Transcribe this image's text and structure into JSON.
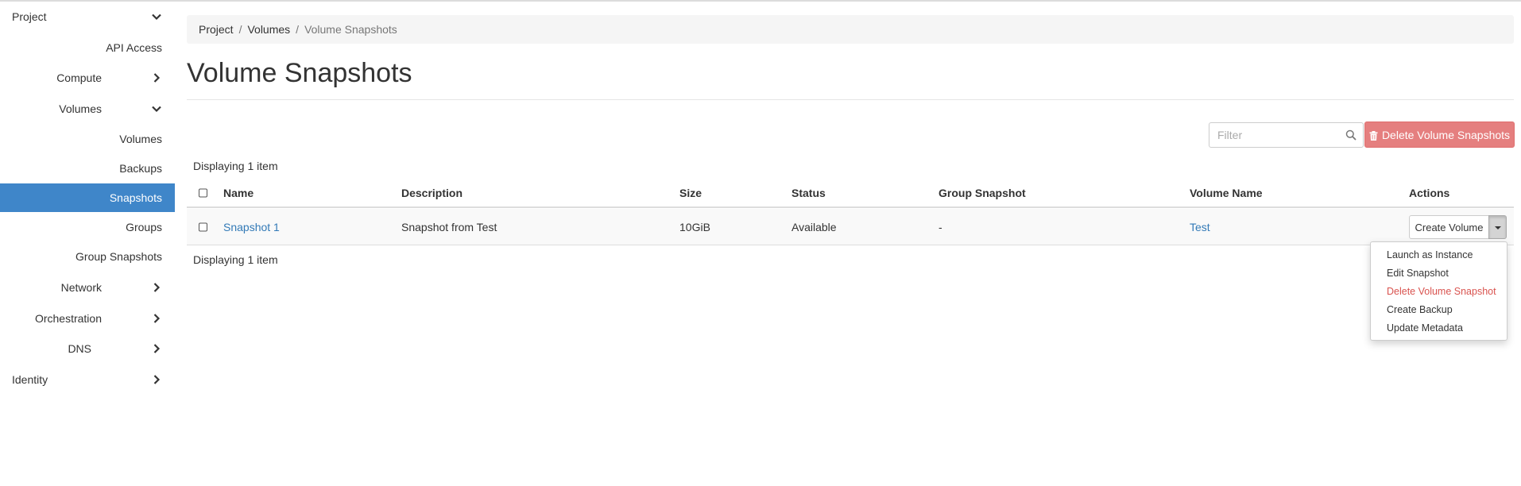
{
  "sidebar": {
    "items": [
      {
        "label": "Project",
        "chevron": "down"
      },
      {
        "label": "API Access"
      },
      {
        "label": "Compute",
        "chevron": "right"
      },
      {
        "label": "Volumes",
        "chevron": "down"
      },
      {
        "label": "Volumes"
      },
      {
        "label": "Backups"
      },
      {
        "label": "Snapshots",
        "active": true
      },
      {
        "label": "Groups"
      },
      {
        "label": "Group Snapshots"
      },
      {
        "label": "Network",
        "chevron": "right"
      },
      {
        "label": "Orchestration",
        "chevron": "right"
      },
      {
        "label": "DNS",
        "chevron": "right"
      },
      {
        "label": "Identity",
        "chevron": "right"
      }
    ]
  },
  "breadcrumb": [
    "Project",
    "Volumes",
    "Volume Snapshots"
  ],
  "breadcrumb_separator": "/",
  "page_title": "Volume Snapshots",
  "toolbar": {
    "filter_placeholder": "Filter",
    "delete_label": "Delete Volume Snapshots"
  },
  "table": {
    "count_text": "Displaying 1 item",
    "headers": [
      "Name",
      "Description",
      "Size",
      "Status",
      "Group Snapshot",
      "Volume Name",
      "Actions"
    ],
    "rows": [
      {
        "name": "Snapshot 1",
        "description": "Snapshot from Test",
        "size": "10GiB",
        "status": "Available",
        "group_snapshot": "-",
        "volume_name": "Test",
        "action": "Create Volume"
      }
    ]
  },
  "dropdown": {
    "items": [
      "Launch as Instance",
      "Edit Snapshot",
      "Delete Volume Snapshot",
      "Create Backup",
      "Update Metadata"
    ]
  },
  "colors": {
    "active_nav": "#3f86c9",
    "link": "#337ab7",
    "danger_button": "#e57f7f",
    "danger_text": "#d9534f"
  }
}
